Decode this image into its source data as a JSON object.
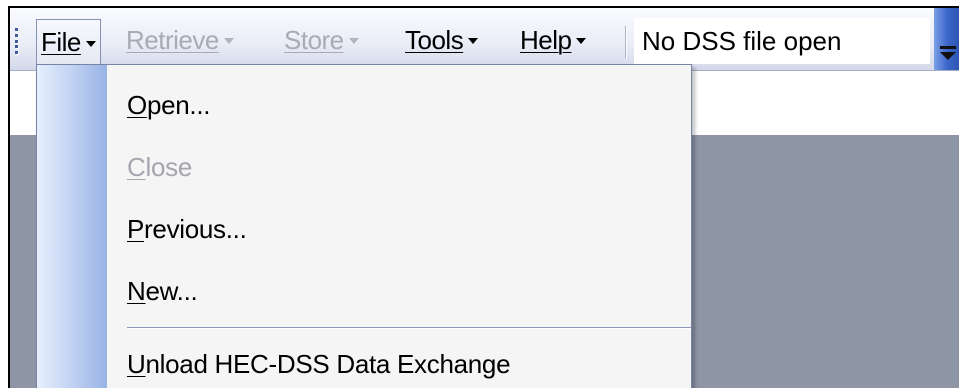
{
  "menubar": {
    "items": [
      {
        "label": "File",
        "enabled": true,
        "active": true
      },
      {
        "label": "Retrieve",
        "enabled": false
      },
      {
        "label": "Store",
        "enabled": false
      },
      {
        "label": "Tools",
        "enabled": true
      },
      {
        "label": "Help",
        "enabled": true
      }
    ],
    "status_text": "No DSS file open"
  },
  "file_menu": {
    "items": [
      {
        "mnemonic": "O",
        "rest": "pen...",
        "enabled": true
      },
      {
        "mnemonic": "C",
        "rest": "lose",
        "enabled": false
      },
      {
        "mnemonic": "P",
        "rest": "revious...",
        "enabled": true
      },
      {
        "mnemonic": "N",
        "rest": "ew...",
        "enabled": true
      },
      {
        "mnemonic": "U",
        "rest": "nload HEC-DSS Data Exchange",
        "enabled": true
      }
    ]
  },
  "colors": {
    "workspace": "#8e95a4",
    "toolbar_accent": "#3b66c9",
    "disabled_text": "#a9aab4"
  },
  "icons": {
    "overflow": "chevron-down-icon",
    "grip": "toolbar-grip-icon"
  }
}
